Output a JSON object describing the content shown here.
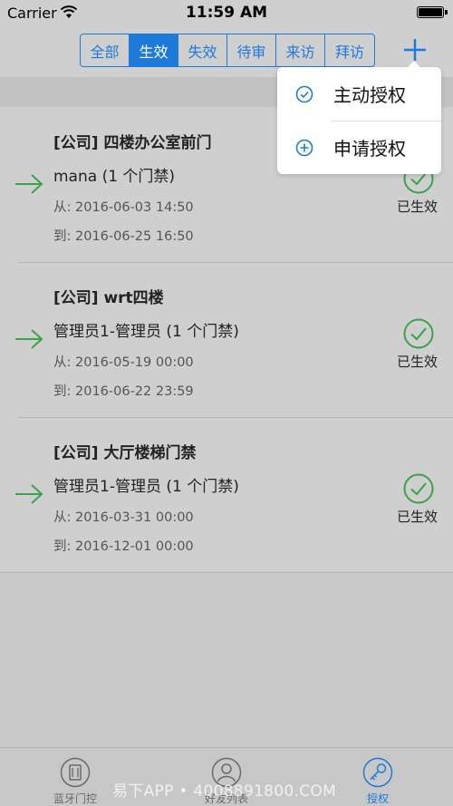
{
  "status_bar": {
    "carrier": "Carrier",
    "time": "11:59 AM"
  },
  "segments": [
    {
      "label": "全部",
      "active": false
    },
    {
      "label": "生效",
      "active": true
    },
    {
      "label": "失效",
      "active": false
    },
    {
      "label": "待审",
      "active": false
    },
    {
      "label": "来访",
      "active": false
    },
    {
      "label": "拜访",
      "active": false
    }
  ],
  "dropdown": {
    "items": [
      {
        "label": "主动授权",
        "icon": "check-circle-icon"
      },
      {
        "label": "申请授权",
        "icon": "plus-circle-icon"
      }
    ]
  },
  "records": [
    {
      "title": "[公司] 四楼办公室前门",
      "user": "mana (1 个门禁)",
      "from": "从: 2016-06-03 14:50",
      "to": "到: 2016-06-25 16:50",
      "status": "已生效"
    },
    {
      "title": "[公司] wrt四楼",
      "user": "管理员1-管理员 (1 个门禁)",
      "from": "从: 2016-05-19 00:00",
      "to": "到: 2016-06-22 23:59",
      "status": "已生效"
    },
    {
      "title": "[公司] 大厅楼梯门禁",
      "user": "管理员1-管理员 (1 个门禁)",
      "from": "从: 2016-03-31 00:00",
      "to": "到: 2016-12-01 00:00",
      "status": "已生效"
    }
  ],
  "tabbar": {
    "items": [
      {
        "label": "蓝牙门控",
        "icon": "bluetooth-door-icon",
        "active": false
      },
      {
        "label": "好友列表",
        "icon": "person-icon",
        "active": false
      },
      {
        "label": "授权",
        "icon": "key-icon",
        "active": true
      }
    ]
  },
  "watermark": "易下APP • 4008891800.COM",
  "colors": {
    "accent": "#1d7ad8",
    "success": "#3aa24a",
    "overlay_bg": "#cfcfcf"
  }
}
